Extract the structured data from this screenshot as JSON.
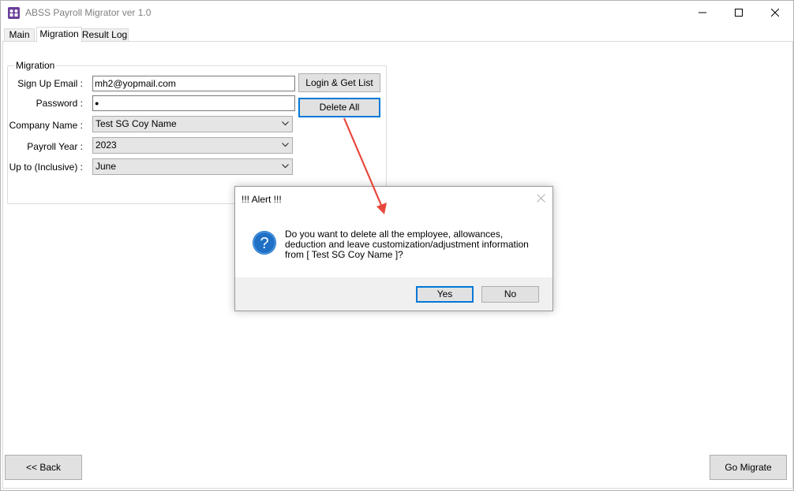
{
  "window": {
    "title": "ABSS Payroll Migrator ver 1.0",
    "controls": [
      "minimize-icon",
      "maximize-icon",
      "close-icon"
    ]
  },
  "tabs": [
    {
      "label": "Main"
    },
    {
      "label": "Migration",
      "active": true
    },
    {
      "label": "Result Log"
    }
  ],
  "migration": {
    "group_title": "Migration",
    "email_label": "Sign Up Email :",
    "email_value": "mh2@yopmail.com",
    "password_label": "Password :",
    "password_value": "●",
    "company_label": "Company Name :",
    "company_value": "Test SG Coy Name",
    "year_label": "Payroll Year :",
    "year_value": "2023",
    "upto_label": "Up to (Inclusive) :",
    "upto_value": "June",
    "login_button": "Login & Get List",
    "delete_button": "Delete All"
  },
  "footer": {
    "back_button": "<< Back",
    "go_button": "Go Migrate"
  },
  "dialog": {
    "title": "!!! Alert !!!",
    "message_lines": [
      "Do you want to delete all the employee, allowances,",
      "deduction and leave customization/adjustment information",
      "from [ Test SG Coy Name ]?"
    ],
    "yes_button": "Yes",
    "no_button": "No",
    "icon": "question-icon"
  },
  "colors": {
    "accent": "#0078d7",
    "annotation_arrow": "#e8483c"
  }
}
